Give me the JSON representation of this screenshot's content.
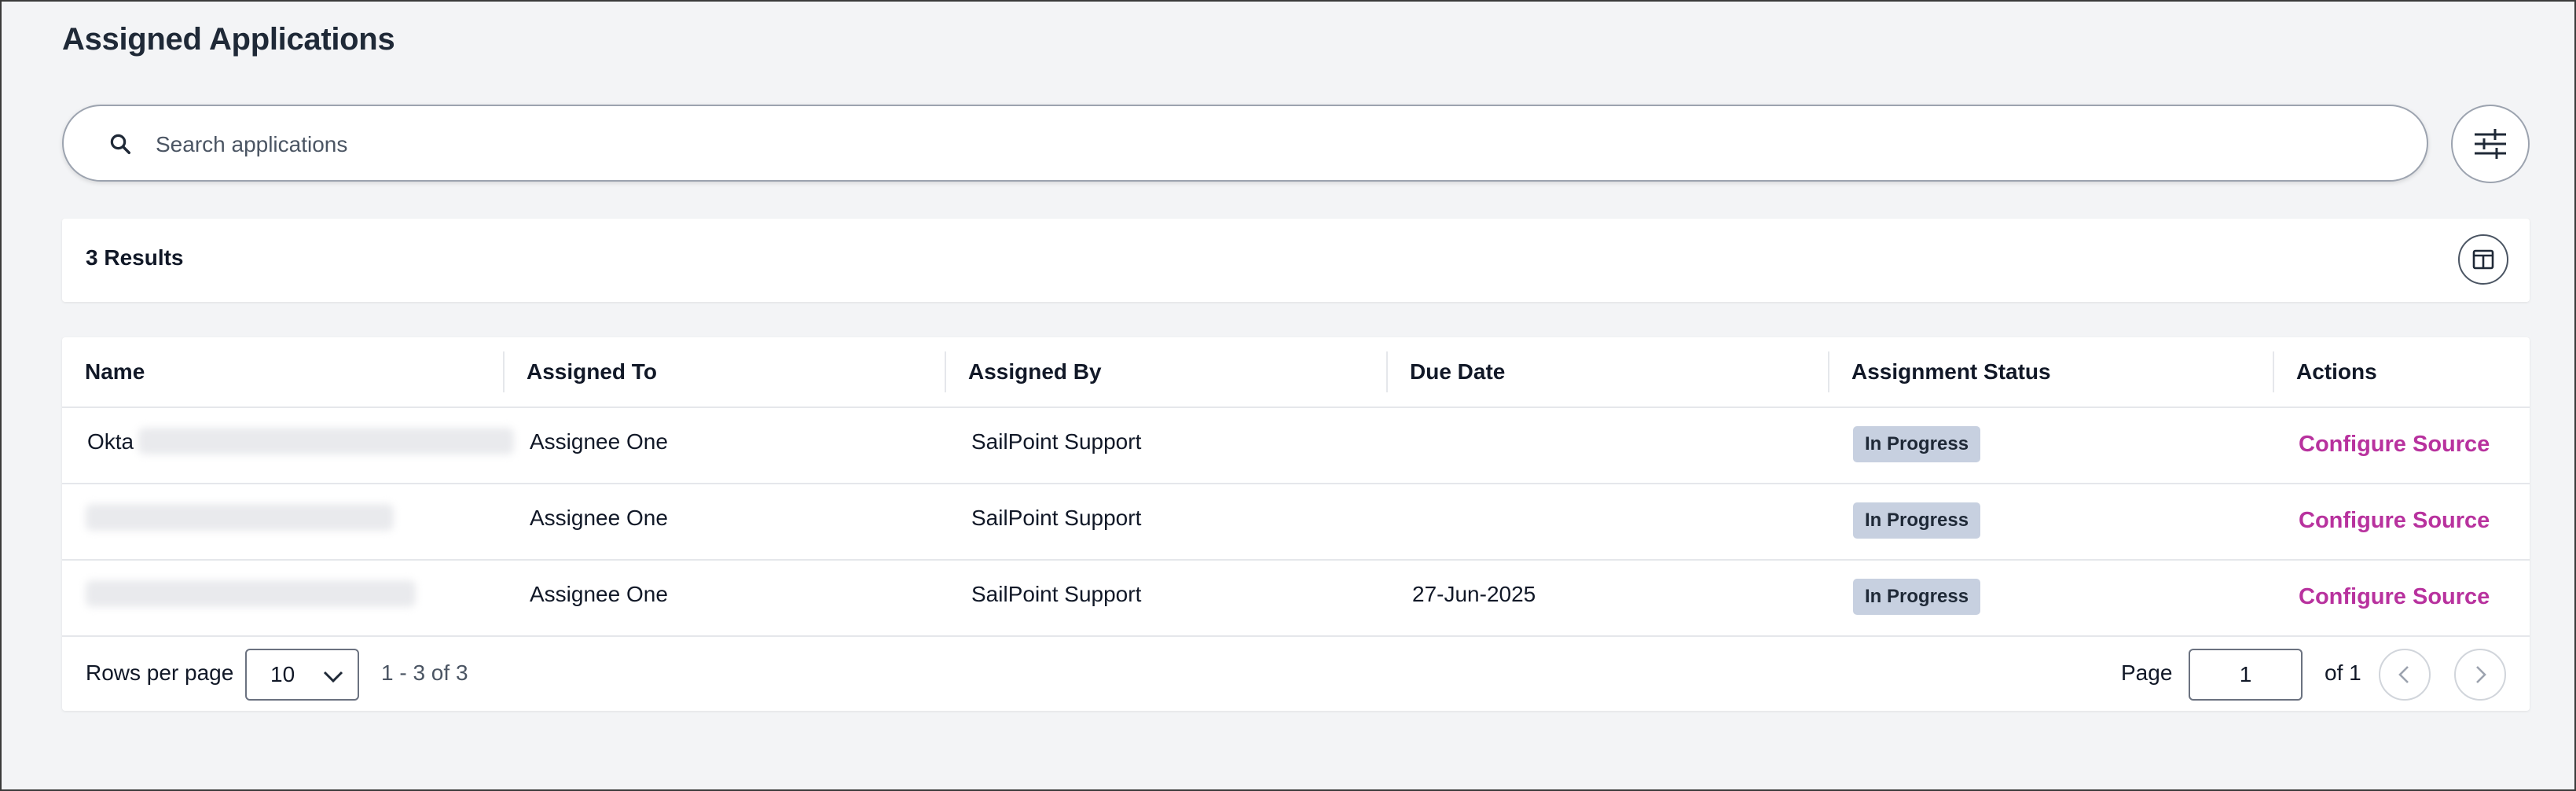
{
  "page": {
    "title": "Assigned Applications"
  },
  "search": {
    "placeholder": "Search applications",
    "icon": "search-icon"
  },
  "toolbar": {
    "filter_icon": "sliders-icon",
    "columns_icon": "columns-icon"
  },
  "results": {
    "count_label": "3 Results"
  },
  "table": {
    "columns": [
      "Name",
      "Assigned To",
      "Assigned By",
      "Due Date",
      "Assignment Status",
      "Actions"
    ],
    "rows": [
      {
        "name": "Okta",
        "assigned_to": "Assignee One",
        "assigned_by": "SailPoint Support",
        "due_date": "",
        "status": "In Progress",
        "action": "Configure Source"
      },
      {
        "name": "",
        "assigned_to": "Assignee One",
        "assigned_by": "SailPoint Support",
        "due_date": "",
        "status": "In Progress",
        "action": "Configure Source"
      },
      {
        "name": "",
        "assigned_to": "Assignee One",
        "assigned_by": "SailPoint Support",
        "due_date": "27-Jun-2025",
        "status": "In Progress",
        "action": "Configure Source"
      }
    ]
  },
  "pagination": {
    "rows_per_page_label": "Rows per page",
    "rows_per_page_value": "10",
    "range_label": "1 - 3 of 3",
    "page_label": "Page",
    "page_value": "1",
    "of_label": "of 1"
  },
  "colors": {
    "accent": "#b8329e",
    "badge_bg": "#c7d0e0",
    "background": "#f3f4f6"
  }
}
